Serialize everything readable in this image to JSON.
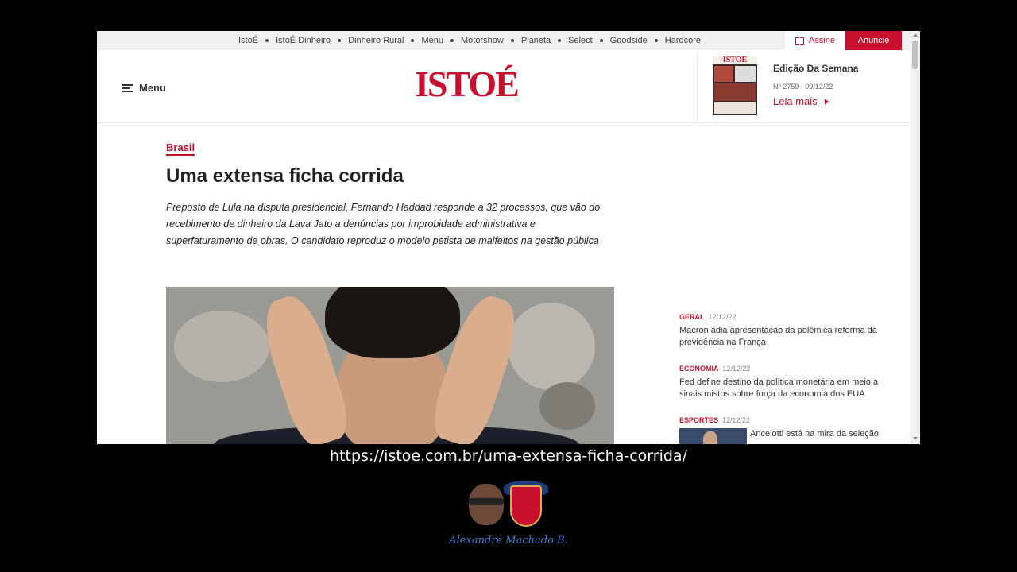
{
  "topbar": {
    "nav_items": [
      "IstoÉ",
      "IstoÉ Dinheiro",
      "Dinheiro Rural",
      "Menu",
      "Motorshow",
      "Planeta",
      "Select",
      "Goodside",
      "Hardcore"
    ],
    "assine_label": "Assine",
    "anuncie_label": "Anuncie"
  },
  "header": {
    "menu_label": "Menu",
    "logo_text": "ISTOÉ",
    "edition": {
      "title": "Edição Da Semana",
      "number": "Nº 2759 - 09/12/22",
      "read_more": "Leia mais"
    }
  },
  "article": {
    "category": "Brasil",
    "title": "Uma extensa ficha corrida",
    "lead": "Preposto de Lula na disputa presidencial, Fernando Haddad responde a 32 processos, que vão do recebimento de dinheiro da Lava Jato a denúncias por improbidade administrativa e superfaturamento de obras. O candidato reproduz o modelo petista de malfeitos na gestão pública"
  },
  "sidebar_news": [
    {
      "category": "GERAL",
      "date": "12/12/22",
      "headline": "Macron adia apresentação da polêmica reforma da previdência na França"
    },
    {
      "category": "ECONOMIA",
      "date": "12/12/22",
      "headline": "Fed define destino da política monetária em meio a sinais mistos sobre força da economia dos EUA"
    },
    {
      "category": "ESPORTES",
      "date": "12/12/22",
      "headline": "Ancelotti está na mira da seleção"
    }
  ],
  "overlay": {
    "url": "https://istoe.com.br/uma-extensa-ficha-corrida/",
    "signature": "Alexandre Machado B."
  },
  "colors": {
    "brand_red": "#c8102e",
    "background": "#000000",
    "signature_blue": "#3d7fd6"
  }
}
